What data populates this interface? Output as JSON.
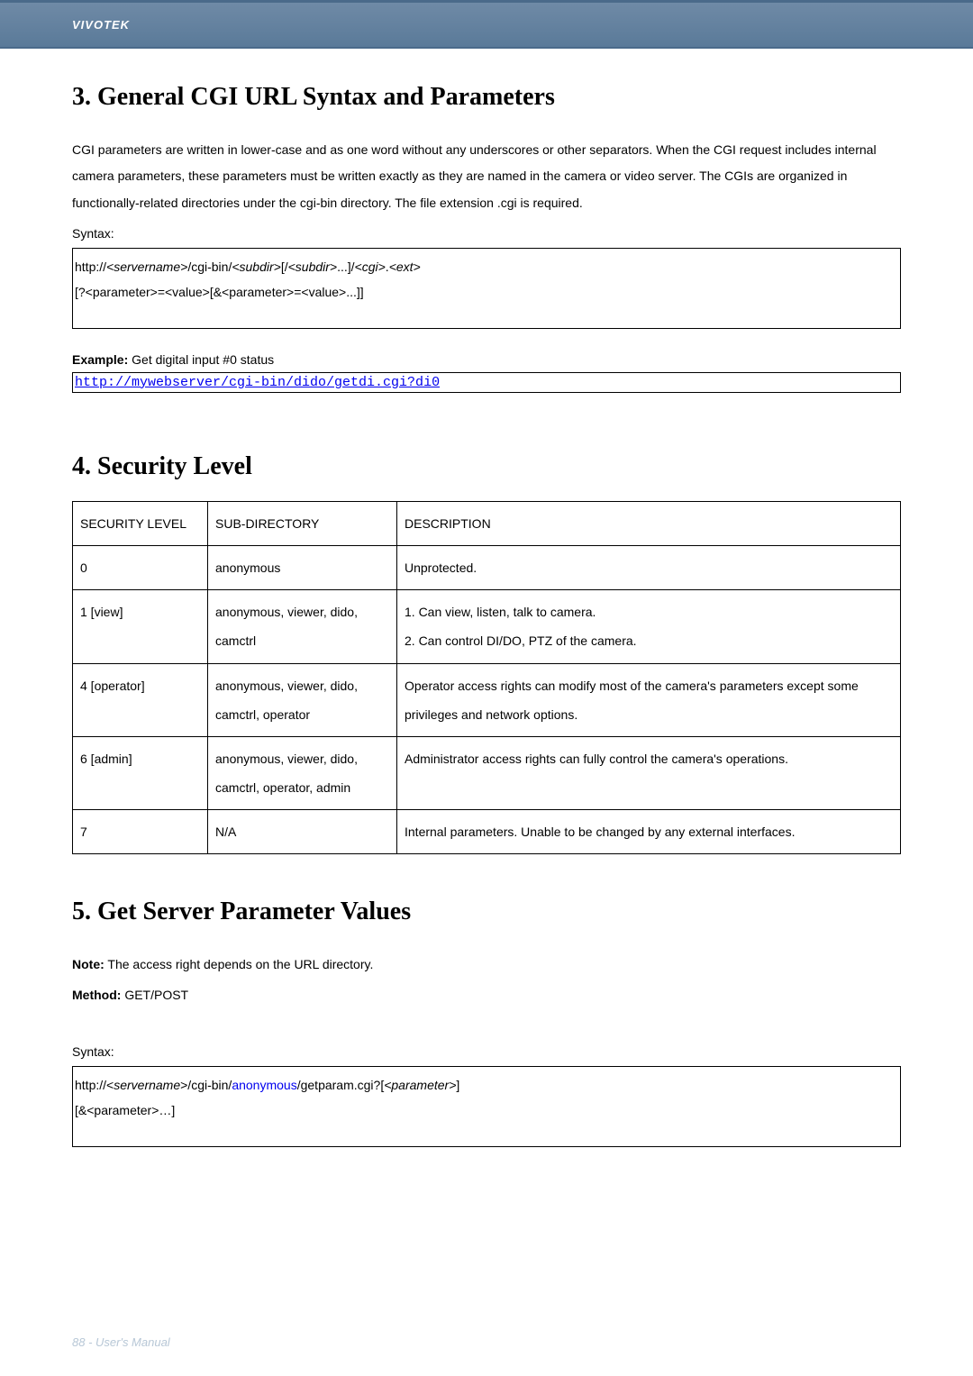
{
  "header": {
    "brand": "VIVOTEK"
  },
  "section3": {
    "title": "3. General CGI URL Syntax and Parameters",
    "para": "CGI parameters are written in lower-case and as one word without any underscores or other separators. When the CGI request includes internal camera parameters, these parameters must be written exactly as they are named in the camera or video server. The CGIs are organized in functionally-related directories under the cgi-bin directory. The file extension .cgi is required.",
    "syntax_label": "Syntax:",
    "syntax_lines": {
      "pre1": "http://",
      "ital1": "<servername>",
      "mid1": "/cgi-bin/",
      "ital2": "<subdir>",
      "mid2": "[/",
      "ital3": "<subdir>",
      "mid3": "...]/",
      "ital4": "<cgi>",
      "mid4": ".",
      "ital5": "<ext>",
      "line2": "[?<parameter>=<value>[&<parameter>=<value>...]]"
    },
    "example_label": "Example:",
    "example_text": " Get digital input #0 status",
    "example_url": "http://mywebserver/cgi-bin/dido/getdi.cgi?di0"
  },
  "section4": {
    "title": "4. Security Level",
    "headers": {
      "c1": "SECURITY LEVEL",
      "c2": "SUB-DIRECTORY",
      "c3": "DESCRIPTION"
    },
    "rows": [
      {
        "level": "0",
        "subdir": "anonymous",
        "desc": "Unprotected."
      },
      {
        "level": "1 [view]",
        "subdir": "anonymous, viewer, dido, camctrl",
        "desc": "1. Can view, listen, talk to camera.\n2. Can control DI/DO, PTZ of the camera."
      },
      {
        "level": "4 [operator]",
        "subdir": "anonymous, viewer, dido, camctrl, operator",
        "desc": "Operator access rights can modify most of the camera's parameters except some privileges and network options."
      },
      {
        "level": "6 [admin]",
        "subdir": "anonymous, viewer, dido, camctrl, operator, admin",
        "desc": "Administrator access rights can fully control the camera's operations."
      },
      {
        "level": "7",
        "subdir": "N/A",
        "desc": "Internal parameters. Unable to be changed by any external interfaces."
      }
    ]
  },
  "section5": {
    "title": "5. Get Server Parameter Values",
    "note_label": "Note:",
    "note_text": " The access right depends on the URL directory.",
    "method_label": "Method:",
    "method_text": " GET/POST",
    "syntax_label": "Syntax:",
    "syntax": {
      "pre1": "http://<",
      "ital1": "servername",
      "mid1": ">/cgi-bin/",
      "blue1": "anonymous",
      "mid2": "/getparam.cgi?[",
      "ital2": "<parameter>",
      "mid3": "]",
      "line2": "[&<parameter>…]"
    }
  },
  "footer": {
    "text": "88 - User's Manual"
  }
}
